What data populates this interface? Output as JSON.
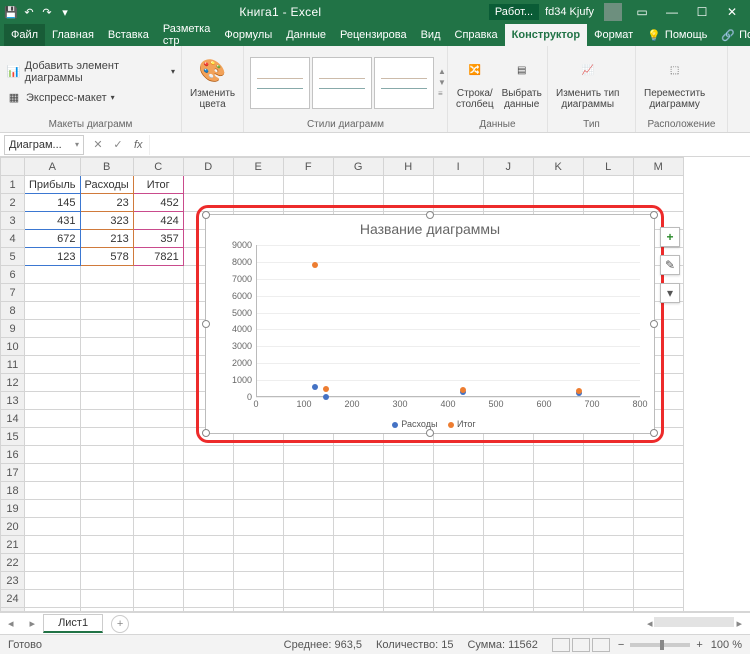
{
  "titlebar": {
    "doc_title": "Книга1 - Excel",
    "badge": "Работ...",
    "user": "fd34 Kjufy"
  },
  "tabs": {
    "file": "Файл",
    "items": [
      "Главная",
      "Вставка",
      "Разметка стр",
      "Формулы",
      "Данные",
      "Рецензирова",
      "Вид",
      "Справка",
      "Конструктор",
      "Формат"
    ],
    "active": "Конструктор",
    "help": "Помощь",
    "share": "Поделиться"
  },
  "ribbon": {
    "g1": {
      "add_element": "Добавить элемент диаграммы",
      "express": "Экспресс-макет",
      "label": "Макеты диаграмм"
    },
    "g2": {
      "change_colors": "Изменить\nцвета"
    },
    "g3": {
      "label": "Стили диаграмм"
    },
    "g4": {
      "swap": "Строка/\nстолбец",
      "select": "Выбрать\nданные",
      "label": "Данные"
    },
    "g5": {
      "change_type": "Изменить тип\nдиаграммы",
      "label": "Тип"
    },
    "g6": {
      "move": "Переместить\nдиаграмму",
      "label": "Расположение"
    }
  },
  "fbar": {
    "namebox": "Диаграм...",
    "fx": "fx"
  },
  "grid": {
    "cols": [
      "A",
      "B",
      "C",
      "D",
      "E",
      "F",
      "G",
      "H",
      "I",
      "J",
      "K",
      "L",
      "M"
    ],
    "headers": [
      "Прибыль",
      "Расходы",
      "Итог"
    ],
    "rows": [
      [
        145,
        23,
        452
      ],
      [
        431,
        323,
        424
      ],
      [
        672,
        213,
        357
      ],
      [
        123,
        578,
        7821
      ]
    ],
    "total_rows": 25
  },
  "chart": {
    "title": "Название диаграммы",
    "legend": [
      "Расходы",
      "Итог"
    ],
    "side": {
      "plus": "+",
      "brush": "✎",
      "filter": "▾"
    }
  },
  "chart_data": {
    "type": "scatter",
    "title": "Название диаграммы",
    "xlabel": "",
    "ylabel": "",
    "xlim": [
      0,
      800
    ],
    "ylim": [
      0,
      9000
    ],
    "xticks": [
      0,
      100,
      200,
      300,
      400,
      500,
      600,
      700,
      800
    ],
    "yticks": [
      0,
      1000,
      2000,
      3000,
      4000,
      5000,
      6000,
      7000,
      8000,
      9000
    ],
    "series": [
      {
        "name": "Расходы",
        "color": "#4472c4",
        "points": [
          {
            "x": 145,
            "y": 23
          },
          {
            "x": 431,
            "y": 323
          },
          {
            "x": 672,
            "y": 213
          },
          {
            "x": 123,
            "y": 578
          }
        ]
      },
      {
        "name": "Итог",
        "color": "#ed7d31",
        "points": [
          {
            "x": 145,
            "y": 452
          },
          {
            "x": 431,
            "y": 424
          },
          {
            "x": 672,
            "y": 357
          },
          {
            "x": 123,
            "y": 7821
          }
        ]
      }
    ]
  },
  "sheetbar": {
    "sheet": "Лист1"
  },
  "status": {
    "ready": "Готово",
    "avg_lbl": "Среднее:",
    "avg": "963,5",
    "cnt_lbl": "Количество:",
    "cnt": "15",
    "sum_lbl": "Сумма:",
    "sum": "11562",
    "zoom": "100 %"
  }
}
